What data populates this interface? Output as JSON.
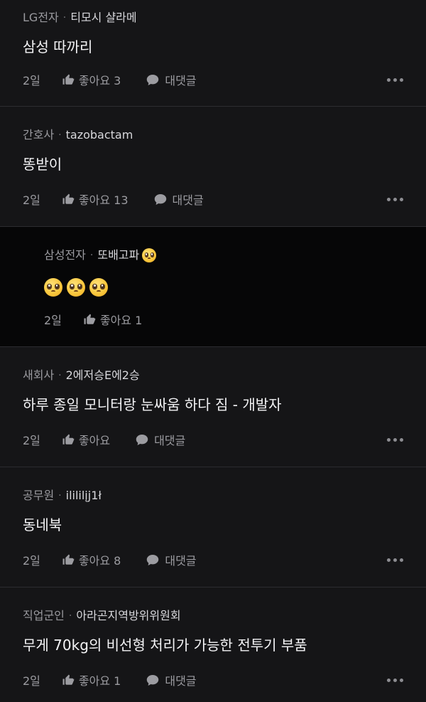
{
  "comments": [
    {
      "company": "LG전자",
      "nick": "티모시 샬라메",
      "body": "삼성 따까리",
      "time": "2일",
      "like": "좋아요 3",
      "reply": "대댓글"
    },
    {
      "company": "간호사",
      "nick": "tazobactam",
      "body": "똥받이",
      "time": "2일",
      "like": "좋아요 13",
      "reply": "대댓글"
    },
    {
      "company": "삼성전자",
      "nick": "또배고파",
      "body": "",
      "time": "2일",
      "like": "좋아요 1",
      "reply": ""
    },
    {
      "company": "새회사",
      "nick": "2에저승E에2승",
      "body": "하루 종일 모니터랑 눈싸움 하다 짐 - 개발자",
      "time": "2일",
      "like": "좋아요",
      "reply": "대댓글"
    },
    {
      "company": "공무원",
      "nick": "ilililįj1ł",
      "body": "동네북",
      "time": "2일",
      "like": "좋아요 8",
      "reply": "대댓글"
    },
    {
      "company": "직업군인",
      "nick": "아라곤지역방위위원회",
      "body": "무게 70kg의 비선형 처리가 가능한 전투기 부품",
      "time": "2일",
      "like": "좋아요 1",
      "reply": "대댓글"
    }
  ],
  "icons": {
    "like": "thumbs-up-icon",
    "reply": "speech-bubble-icon",
    "more": "more-horizontal-icon",
    "emoji": "pleading-face-emoji"
  },
  "colors": {
    "background": "#151517",
    "reply_background": "#060607",
    "divider": "#2c2c30",
    "meta_text": "#9a9a9f"
  }
}
